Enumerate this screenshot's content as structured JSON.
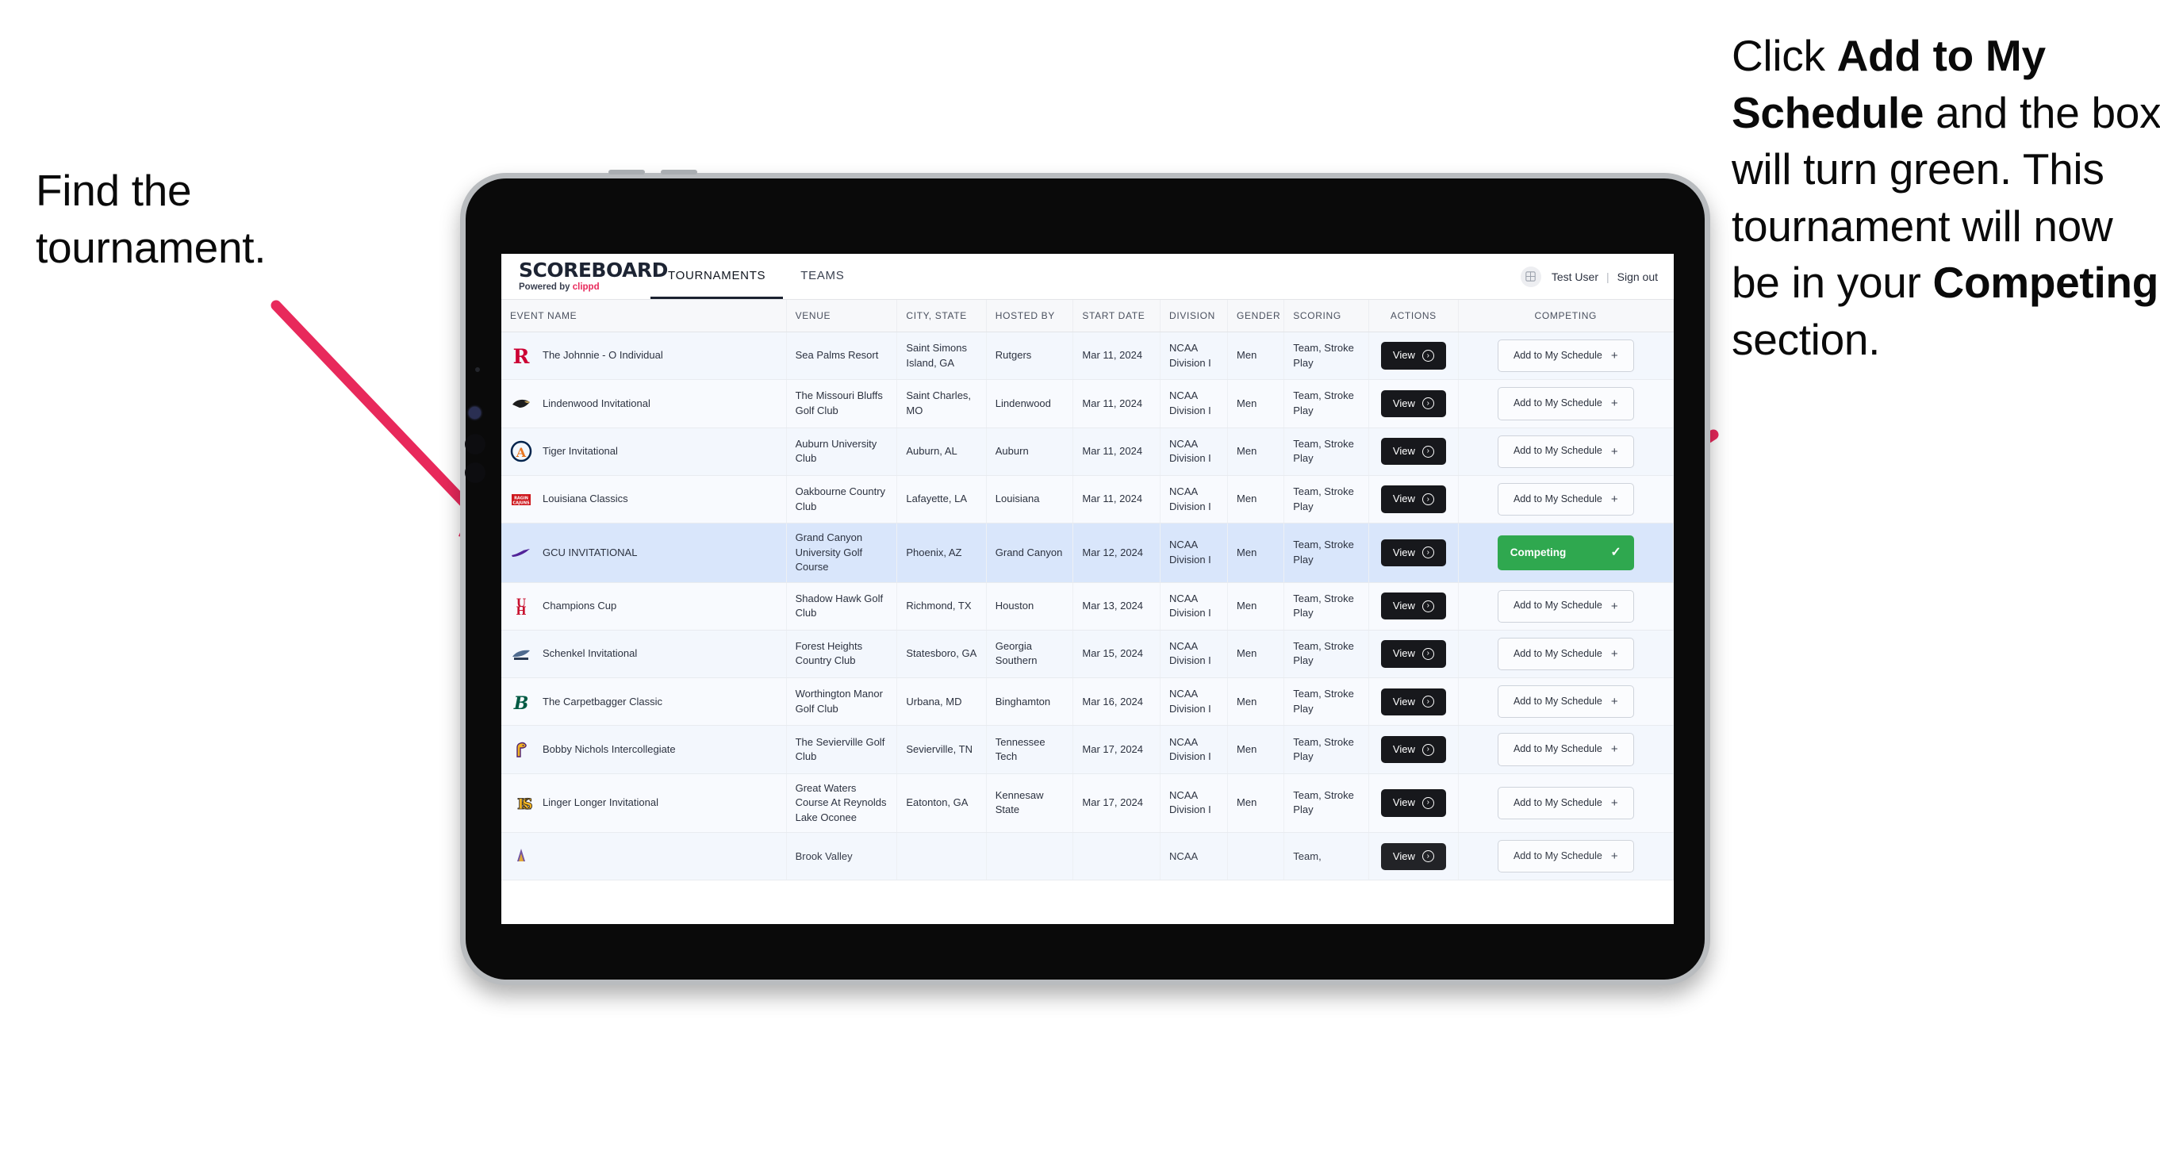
{
  "annotations": {
    "left": {
      "parts": [
        {
          "text": "Find the tournament.",
          "bold": false
        }
      ]
    },
    "right": {
      "p1": "Click ",
      "b1": "Add to My Schedule",
      "p2": " and the box will turn green. This tournament will now be in your ",
      "b2": "Competing",
      "p3": " section."
    },
    "arrow_color": "#e8295b"
  },
  "app": {
    "brand": {
      "title": "SCOREBOARD",
      "powered_prefix": "Powered by ",
      "powered_name": "clippd"
    },
    "nav": {
      "tabs": [
        {
          "label": "TOURNAMENTS",
          "active": true
        },
        {
          "label": "TEAMS",
          "active": false
        }
      ]
    },
    "user": {
      "name": "Test User",
      "separator": "|",
      "signout": "Sign out",
      "avatar_icon": "grid-icon"
    },
    "table": {
      "columns": [
        "EVENT NAME",
        "VENUE",
        "CITY, STATE",
        "HOSTED BY",
        "START DATE",
        "DIVISION",
        "GENDER",
        "SCORING",
        "ACTIONS",
        "COMPETING"
      ],
      "view_label": "View",
      "add_label": "Add to My Schedule",
      "competing_label": "Competing",
      "rows": [
        {
          "event": "The Johnnie - O Individual",
          "venue": "Sea Palms Resort",
          "city": "Saint Simons Island, GA",
          "host": "Rutgers",
          "date": "Mar 11, 2024",
          "division": "NCAA Division I",
          "gender": "Men",
          "scoring": "Team, Stroke Play",
          "competing": false,
          "logo": "rutgers-logo"
        },
        {
          "event": "Lindenwood Invitational",
          "venue": "The Missouri Bluffs Golf Club",
          "city": "Saint Charles, MO",
          "host": "Lindenwood",
          "date": "Mar 11, 2024",
          "division": "NCAA Division I",
          "gender": "Men",
          "scoring": "Team, Stroke Play",
          "competing": false,
          "logo": "lindenwood-logo"
        },
        {
          "event": "Tiger Invitational",
          "venue": "Auburn University Club",
          "city": "Auburn, AL",
          "host": "Auburn",
          "date": "Mar 11, 2024",
          "division": "NCAA Division I",
          "gender": "Men",
          "scoring": "Team, Stroke Play",
          "competing": false,
          "logo": "auburn-logo"
        },
        {
          "event": "Louisiana Classics",
          "venue": "Oakbourne Country Club",
          "city": "Lafayette, LA",
          "host": "Louisiana",
          "date": "Mar 11, 2024",
          "division": "NCAA Division I",
          "gender": "Men",
          "scoring": "Team, Stroke Play",
          "competing": false,
          "logo": "ragin-cajuns-logo"
        },
        {
          "event": "GCU INVITATIONAL",
          "venue": "Grand Canyon University Golf Course",
          "city": "Phoenix, AZ",
          "host": "Grand Canyon",
          "date": "Mar 12, 2024",
          "division": "NCAA Division I",
          "gender": "Men",
          "scoring": "Team, Stroke Play",
          "competing": true,
          "logo": "grand-canyon-logo"
        },
        {
          "event": "Champions Cup",
          "venue": "Shadow Hawk Golf Club",
          "city": "Richmond, TX",
          "host": "Houston",
          "date": "Mar 13, 2024",
          "division": "NCAA Division I",
          "gender": "Men",
          "scoring": "Team, Stroke Play",
          "competing": false,
          "logo": "houston-logo"
        },
        {
          "event": "Schenkel Invitational",
          "venue": "Forest Heights Country Club",
          "city": "Statesboro, GA",
          "host": "Georgia Southern",
          "date": "Mar 15, 2024",
          "division": "NCAA Division I",
          "gender": "Men",
          "scoring": "Team, Stroke Play",
          "competing": false,
          "logo": "georgia-southern-logo"
        },
        {
          "event": "The Carpetbagger Classic",
          "venue": "Worthington Manor Golf Club",
          "city": "Urbana, MD",
          "host": "Binghamton",
          "date": "Mar 16, 2024",
          "division": "NCAA Division I",
          "gender": "Men",
          "scoring": "Team, Stroke Play",
          "competing": false,
          "logo": "binghamton-logo"
        },
        {
          "event": "Bobby Nichols Intercollegiate",
          "venue": "The Sevierville Golf Club",
          "city": "Sevierville, TN",
          "host": "Tennessee Tech",
          "date": "Mar 17, 2024",
          "division": "NCAA Division I",
          "gender": "Men",
          "scoring": "Team, Stroke Play",
          "competing": false,
          "logo": "tennessee-tech-logo"
        },
        {
          "event": "Linger Longer Invitational",
          "venue": "Great Waters Course At Reynolds Lake Oconee",
          "city": "Eatonton, GA",
          "host": "Kennesaw State",
          "date": "Mar 17, 2024",
          "division": "NCAA Division I",
          "gender": "Men",
          "scoring": "Team, Stroke Play",
          "competing": false,
          "logo": "kennesaw-state-logo"
        },
        {
          "event": "",
          "venue": "Brook Valley",
          "city": "",
          "host": "",
          "date": "",
          "division": "NCAA",
          "gender": "",
          "scoring": "Team,",
          "competing": false,
          "logo": "partial-logo"
        }
      ]
    }
  },
  "colors": {
    "accent_pink": "#e8295b",
    "competing_green": "#2fa84f",
    "dark_button": "#17181c",
    "selected_row": "#d9e6fb"
  }
}
